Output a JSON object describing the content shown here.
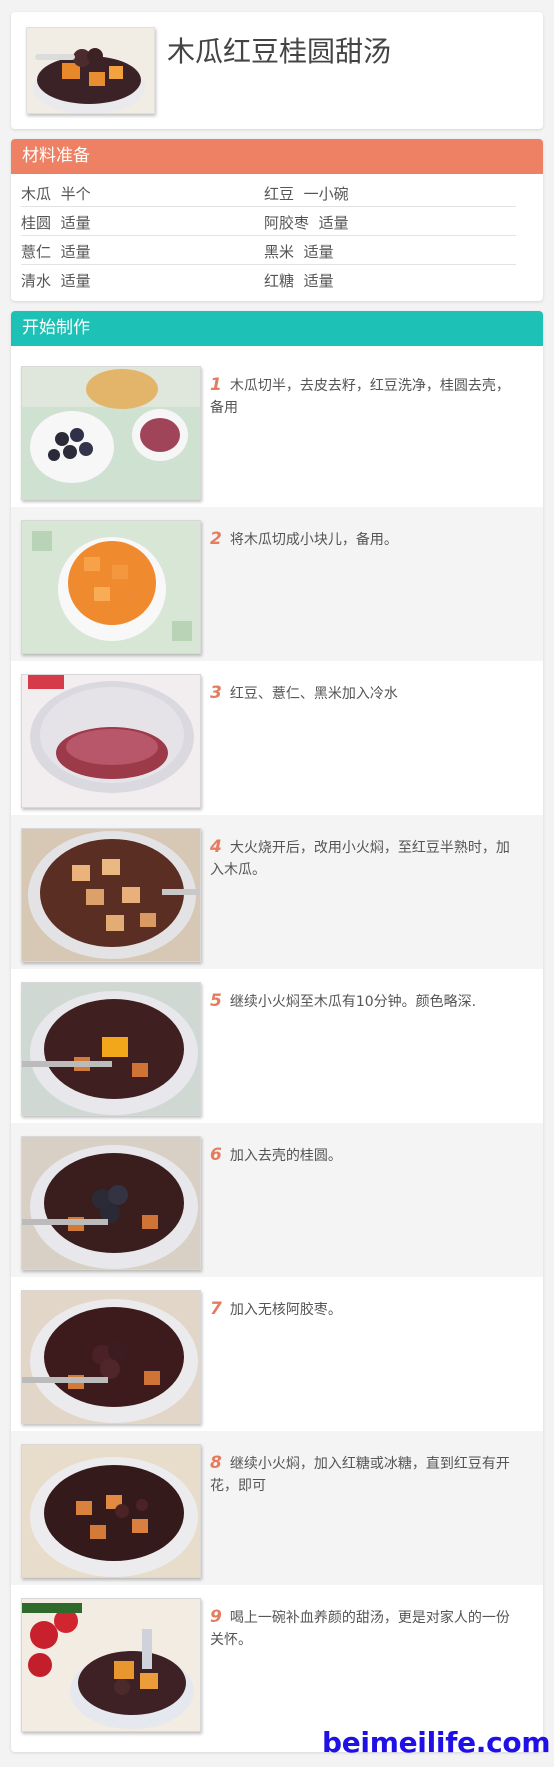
{
  "title": "木瓜红豆桂圆甜汤",
  "materials": {
    "header": "材料准备",
    "rows": [
      [
        {
          "name": "木瓜",
          "amount": "半个"
        },
        {
          "name": "红豆",
          "amount": "一小碗"
        }
      ],
      [
        {
          "name": "桂圆",
          "amount": "适量"
        },
        {
          "name": "阿胶枣",
          "amount": "适量"
        }
      ],
      [
        {
          "name": "薏仁",
          "amount": "适量"
        },
        {
          "name": "黑米",
          "amount": "适量"
        }
      ],
      [
        {
          "name": "清水",
          "amount": "适量"
        },
        {
          "name": "红糖",
          "amount": "适量"
        }
      ]
    ]
  },
  "steps": {
    "header": "开始制作",
    "items": [
      {
        "num": "1",
        "text": "木瓜切半，去皮去籽，红豆洗净，桂圆去壳，备用"
      },
      {
        "num": "2",
        "text": "将木瓜切成小块儿，备用。"
      },
      {
        "num": "3",
        "text": "红豆、薏仁、黑米加入冷水"
      },
      {
        "num": "4",
        "text": "大火烧开后，改用小火焖，至红豆半熟时，加入木瓜。"
      },
      {
        "num": "5",
        "text": "继续小火焖至木瓜有10分钟。颜色略深."
      },
      {
        "num": "6",
        "text": "加入去壳的桂圆。"
      },
      {
        "num": "7",
        "text": "加入无核阿胶枣。"
      },
      {
        "num": "8",
        "text": "继续小火焖，加入红糖或冰糖，直到红豆有开花，即可"
      },
      {
        "num": "9",
        "text": "喝上一碗补血养颜的甜汤，更是对家人的一份关怀。"
      }
    ]
  },
  "watermark": "beimeilife.com"
}
